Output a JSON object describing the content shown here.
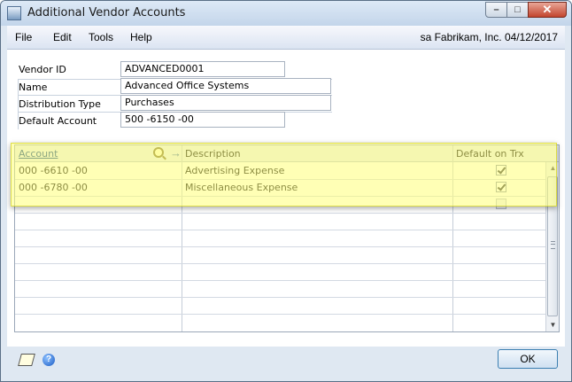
{
  "window": {
    "title": "Additional Vendor Accounts",
    "controls": {
      "minimize": "–",
      "maximize": "□",
      "close": "✕"
    }
  },
  "menu": {
    "items": [
      "File",
      "Edit",
      "Tools",
      "Help"
    ],
    "status": "sa  Fabrikam, Inc.  04/12/2017"
  },
  "form": {
    "fields": [
      {
        "label": "Vendor ID",
        "value": "ADVANCED0001"
      },
      {
        "label": "Name",
        "value": "Advanced Office Systems"
      },
      {
        "label": "Distribution Type",
        "value": "Purchases"
      },
      {
        "label": "Default Account",
        "value": "500 -6150 -00"
      }
    ]
  },
  "grid": {
    "columns": [
      "Account",
      "Description",
      "Default on Trx"
    ],
    "rows": [
      {
        "account": "000 -6610 -00",
        "description": "Advertising Expense",
        "default": true
      },
      {
        "account": "000 -6780 -00",
        "description": "Miscellaneous Expense",
        "default": true
      },
      {
        "account": "",
        "description": "",
        "default": false
      }
    ],
    "scroll": {
      "up": "▲",
      "down": "▼"
    }
  },
  "footer": {
    "ok_label": "OK",
    "help_glyph": "?"
  },
  "colors": {
    "highlight": "#ffff78",
    "window_bg": "#dfe8f2",
    "link": "#003a8c"
  },
  "icons": [
    "app-icon",
    "lookup-icon",
    "expand-arrow-icon",
    "note-icon",
    "help-icon"
  ]
}
